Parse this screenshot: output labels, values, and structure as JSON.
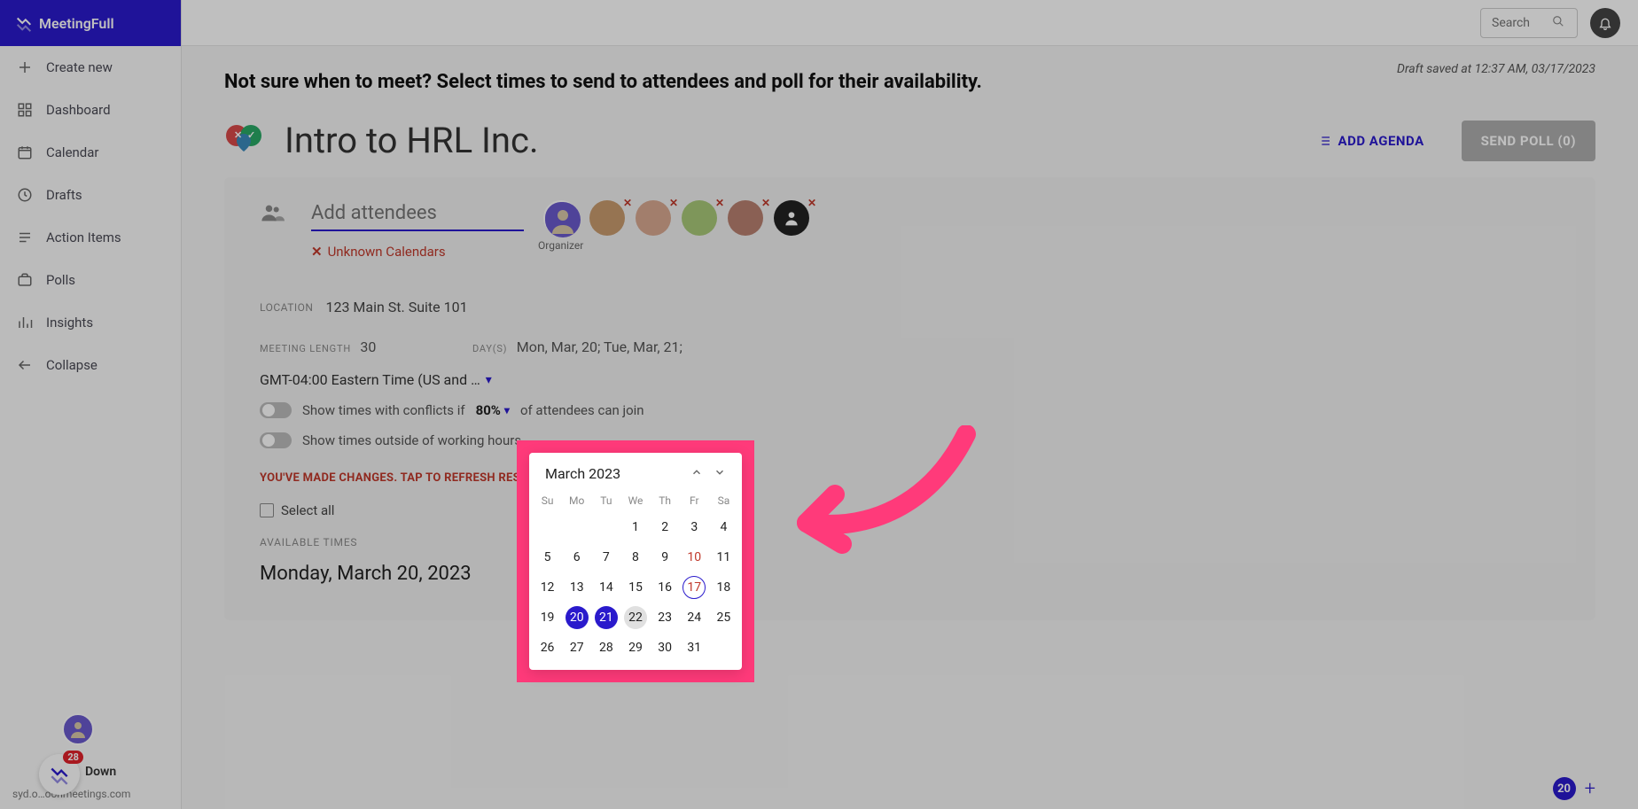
{
  "brand": "MeetingFull",
  "sidebar": {
    "items": [
      {
        "icon": "plus-icon",
        "label": "Create new"
      },
      {
        "icon": "dashboard-icon",
        "label": "Dashboard"
      },
      {
        "icon": "calendar-icon",
        "label": "Calendar"
      },
      {
        "icon": "clock-icon",
        "label": "Drafts"
      },
      {
        "icon": "list-icon",
        "label": "Action Items"
      },
      {
        "icon": "briefcase-icon",
        "label": "Polls"
      },
      {
        "icon": "bars-icon",
        "label": "Insights"
      },
      {
        "icon": "arrow-left-icon",
        "label": "Collapse"
      }
    ],
    "badge_count": "28",
    "user_status": "Down",
    "footer_email": "syd.o…oonmeetings.com"
  },
  "topbar": {
    "search_placeholder": "Search"
  },
  "main": {
    "draft_saved": "Draft saved at 12:37 AM, 03/17/2023",
    "headline": "Not sure when to meet? Select times to send to attendees and poll for their availability.",
    "meeting_title": "Intro to HRL Inc.",
    "add_agenda": "ADD AGENDA",
    "send_poll": "SEND POLL (0)",
    "attendees": {
      "placeholder": "Add attendees",
      "organizer_label": "Organizer",
      "unknown": "Unknown Calendars"
    },
    "location_label": "LOCATION",
    "location_value": "123 Main St. Suite 101",
    "length_label": "MEETING LENGTH",
    "length_value": "30",
    "days_label": "DAY(S)",
    "days_value": "Mon, Mar, 20; Tue, Mar, 21;",
    "timezone": "GMT-04:00 Eastern Time (US and …",
    "toggle1_pre": "Show times with conflicts if",
    "toggle1_pct": "80%",
    "toggle1_post": "of attendees can join",
    "toggle2": "Show times outside of working hours",
    "refresh_warn": "YOU'VE MADE CHANGES. TAP TO REFRESH RESULTS",
    "select_all": "Select all",
    "available_times": "AVAILABLE TIMES",
    "day_heading": "Monday, March 20, 2023",
    "selected_count": "20"
  },
  "calendar": {
    "title": "March 2023",
    "dow": [
      "Su",
      "Mo",
      "Tu",
      "We",
      "Th",
      "Fr",
      "Sa"
    ],
    "weeks": [
      [
        null,
        null,
        null,
        1,
        2,
        3,
        4
      ],
      [
        5,
        6,
        7,
        8,
        9,
        10,
        11
      ],
      [
        12,
        13,
        14,
        15,
        16,
        17,
        18
      ],
      [
        19,
        20,
        21,
        22,
        23,
        24,
        25
      ],
      [
        26,
        27,
        28,
        29,
        30,
        31,
        null
      ]
    ],
    "red_days": [
      10,
      17
    ],
    "today": 17,
    "selected": [
      20,
      21
    ],
    "hovered": 22
  },
  "colors": {
    "primary": "#2a1acc",
    "danger": "#c0392b",
    "annotation": "#ff3a7a"
  }
}
